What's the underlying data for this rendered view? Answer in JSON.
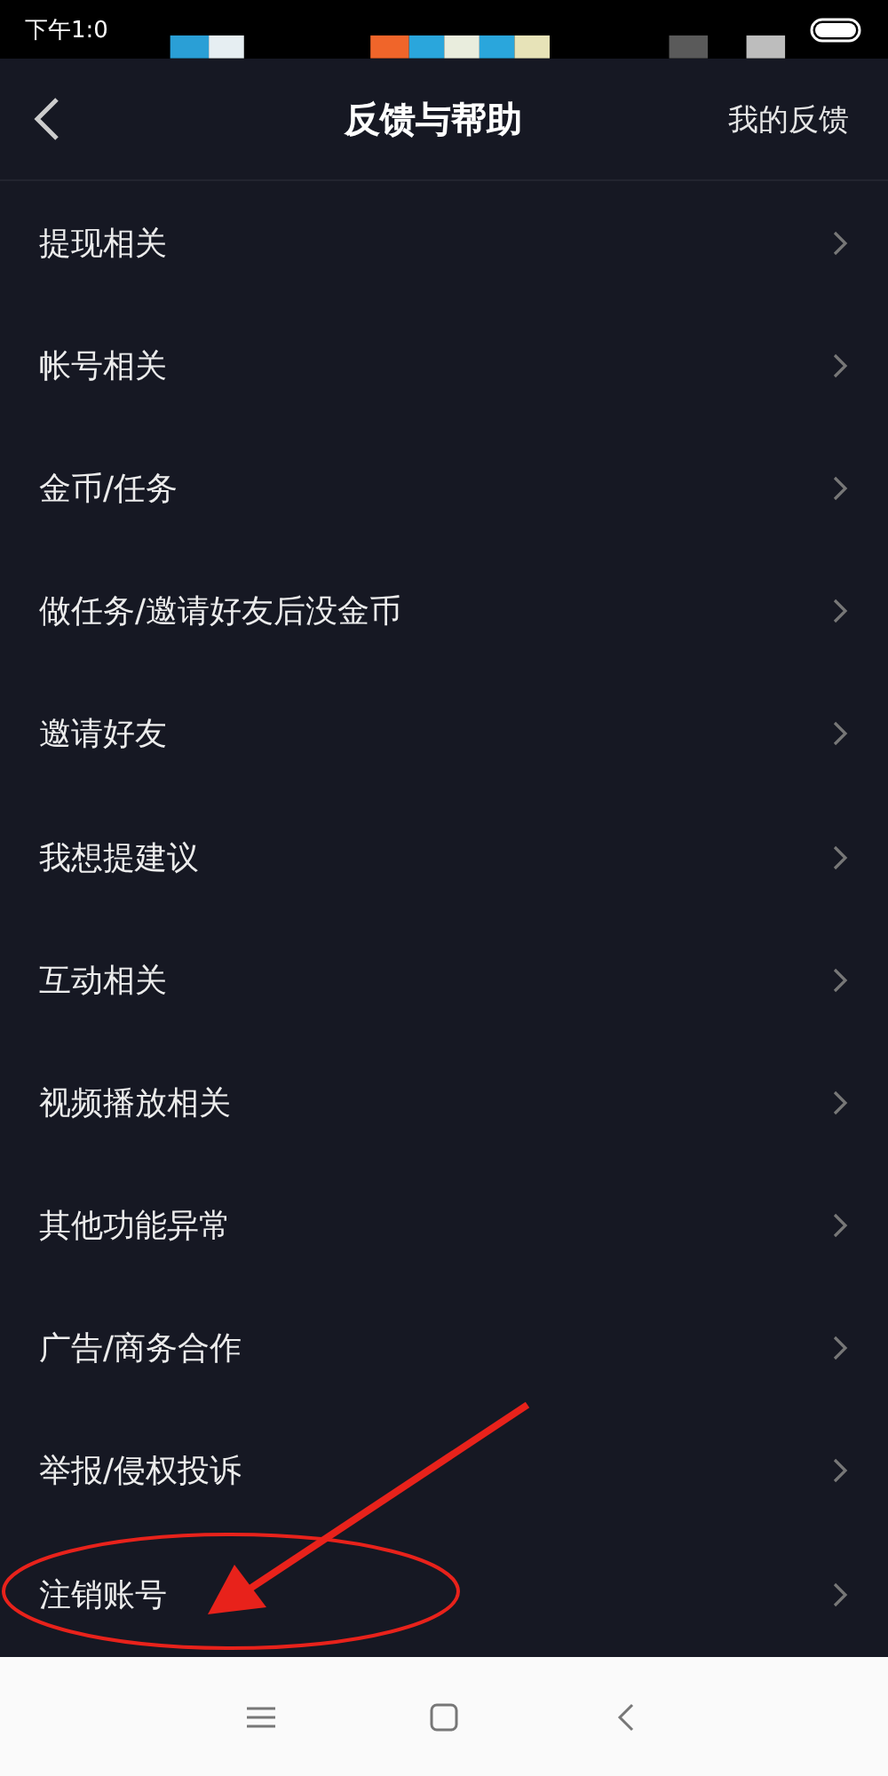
{
  "status_bar": {
    "time": "下午1:0"
  },
  "header": {
    "title": "反馈与帮助",
    "action": "我的反馈"
  },
  "items": [
    {
      "label": "提现相关",
      "circled": false
    },
    {
      "label": "帐号相关",
      "circled": false
    },
    {
      "label": "金币/任务",
      "circled": false
    },
    {
      "label": "做任务/邀请好友后没金币",
      "circled": false
    },
    {
      "label": "邀请好友",
      "circled": false
    },
    {
      "label": "我想提建议",
      "circled": false
    },
    {
      "label": "互动相关",
      "circled": false
    },
    {
      "label": "视频播放相关",
      "circled": false
    },
    {
      "label": "其他功能异常",
      "circled": false
    },
    {
      "label": "广告/商务合作",
      "circled": false
    },
    {
      "label": "举报/侵权投诉",
      "circled": false
    },
    {
      "label": "注销账号",
      "circled": true
    }
  ]
}
